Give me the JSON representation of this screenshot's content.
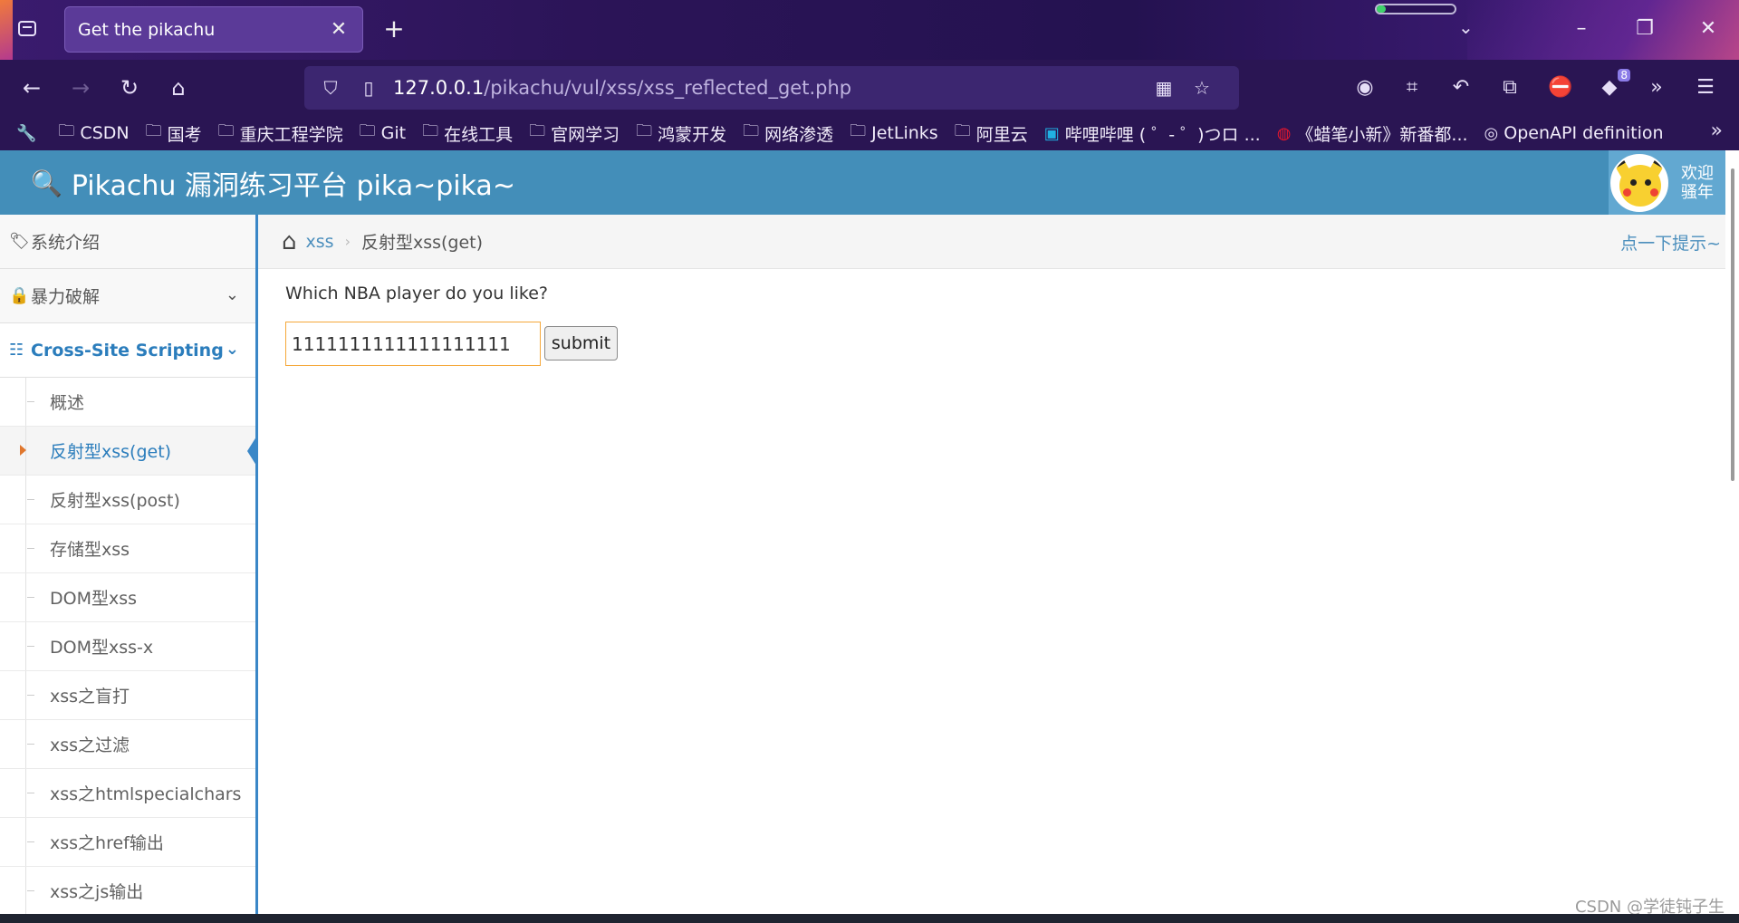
{
  "browser": {
    "tab_title": "Get the pikachu",
    "tab_close": "✕",
    "new_tab": "+",
    "url_host": "127.0.0.1",
    "url_path": "/pikachu/vul/xss/xss_reflected_get.php",
    "extension_badge": "8",
    "bookmarks": [
      {
        "label": "CSDN",
        "icon": "folder-icon"
      },
      {
        "label": "国考",
        "icon": "folder-icon"
      },
      {
        "label": "重庆工程学院",
        "icon": "folder-icon"
      },
      {
        "label": "Git",
        "icon": "folder-icon"
      },
      {
        "label": "在线工具",
        "icon": "folder-icon"
      },
      {
        "label": "官网学习",
        "icon": "folder-icon"
      },
      {
        "label": "鸿蒙开发",
        "icon": "folder-icon"
      },
      {
        "label": "网络渗透",
        "icon": "folder-icon"
      },
      {
        "label": "JetLinks",
        "icon": "folder-icon"
      },
      {
        "label": "阿里云",
        "icon": "folder-icon"
      },
      {
        "label": "哔哩哔哩 ( ゜- ゜)つロ ...",
        "icon": "bilibili-icon"
      },
      {
        "label": "《蜡笔小新》新番都...",
        "icon": "weibo-icon"
      },
      {
        "label": "OpenAPI definition",
        "icon": "globe-icon"
      }
    ]
  },
  "header": {
    "brand": "Pikachu 漏洞练习平台 pika~pika~",
    "welcome_line1": "欢迎",
    "welcome_line2": "骚年"
  },
  "sidebar": {
    "items": [
      {
        "label": "系统介绍",
        "icon": "tags-icon"
      },
      {
        "label": "暴力破解",
        "icon": "lock-icon"
      },
      {
        "label": "Cross-Site Scripting",
        "icon": "list-icon"
      }
    ],
    "subitems": [
      "概述",
      "反射型xss(get)",
      "反射型xss(post)",
      "存储型xss",
      "DOM型xss",
      "DOM型xss-x",
      "xss之盲打",
      "xss之过滤",
      "xss之htmlspecialchars",
      "xss之href输出",
      "xss之js输出"
    ]
  },
  "breadcrumb": {
    "section": "xss",
    "current": "反射型xss(get)",
    "hint": "点一下提示~"
  },
  "main": {
    "question": "Which NBA player do you like?",
    "input_value": "1111111111111111111",
    "submit_label": "submit"
  },
  "watermark": "CSDN @学徒钝子生",
  "colors": {
    "header_blue": "#438eb9",
    "link_blue": "#2b7dbc",
    "browser_purple": "#2a1553",
    "input_focus": "#f5a83a"
  }
}
